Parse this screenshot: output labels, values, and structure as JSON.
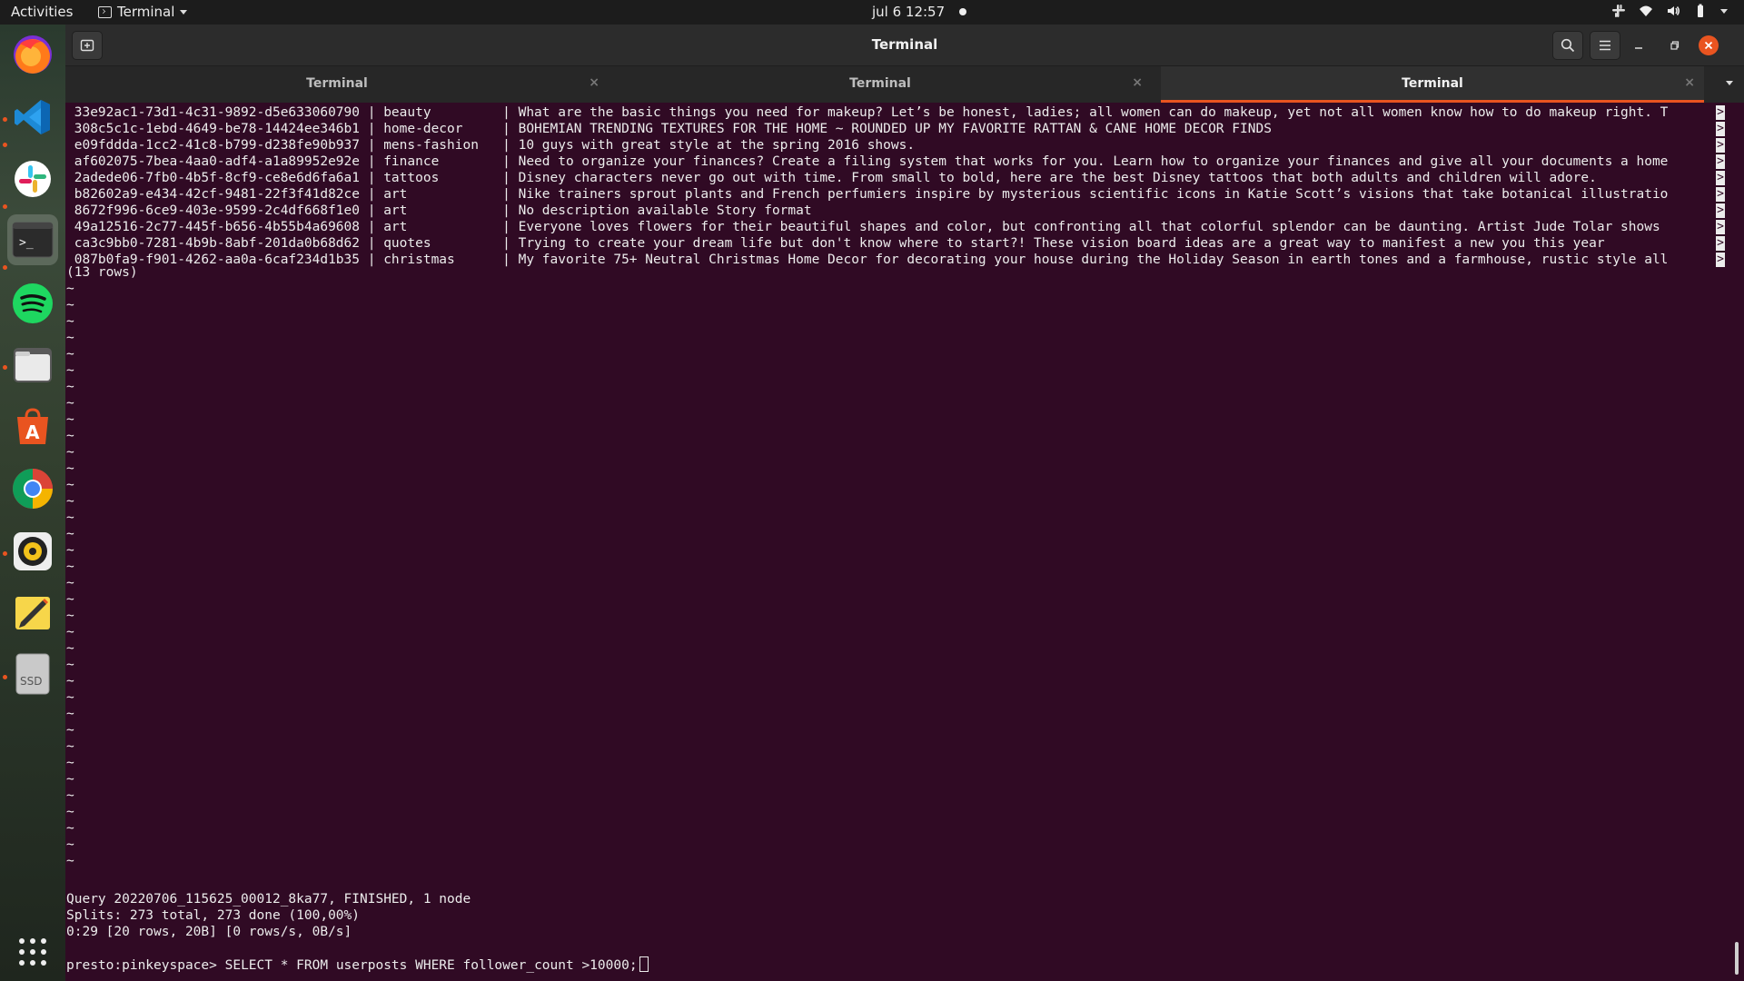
{
  "topbar": {
    "activities": "Activities",
    "app_name": "Terminal",
    "clock": "jul 6  12:57"
  },
  "dock": {
    "items": [
      {
        "name": "firefox-icon",
        "running": true
      },
      {
        "name": "vscode-icon",
        "running": true
      },
      {
        "name": "slack-icon",
        "running": true
      },
      {
        "name": "terminal-icon",
        "running": true,
        "active": true
      },
      {
        "name": "spotify-icon",
        "running": false
      },
      {
        "name": "files-icon",
        "running": true
      },
      {
        "name": "app-center-icon",
        "running": false
      },
      {
        "name": "chrome-icon",
        "running": false
      },
      {
        "name": "rhythmbox-icon",
        "running": true
      },
      {
        "name": "text-editor-icon",
        "running": false
      },
      {
        "name": "ssd-drive-icon",
        "running": true
      }
    ],
    "ssd_label": "SSD"
  },
  "window": {
    "title": "Terminal",
    "tabs": [
      {
        "label": "Terminal",
        "close": "×",
        "active": false
      },
      {
        "label": "Terminal",
        "close": "×",
        "active": false
      },
      {
        "label": "Terminal",
        "close": "×",
        "active": true
      }
    ]
  },
  "terminal": {
    "rows": [
      {
        "id": "33e92ac1-73d1-4c31-9892-d5e633060790",
        "category": "beauty",
        "description": "What are the basic things you need for makeup? Let’s be honest, ladies; all women can do makeup, yet not all women know how to do makeup right. T",
        "overflow": true
      },
      {
        "id": "308c5c1c-1ebd-4649-be78-14424ee346b1",
        "category": "home-decor",
        "description": "BOHEMIAN TRENDING TEXTURES FOR THE HOME ~ ROUNDED UP MY FAVORITE RATTAN & CANE HOME DECOR FINDS",
        "overflow": false
      },
      {
        "id": "e09fddda-1cc2-41c8-b799-d238fe90b937",
        "category": "mens-fashion",
        "description": "10 guys with great style at the spring 2016 shows.",
        "overflow": false
      },
      {
        "id": "af602075-7bea-4aa0-adf4-a1a89952e92e",
        "category": "finance",
        "description": "Need to organize your finances? Create a filing system that works for you. Learn how to organize your finances and give all your documents a home",
        "overflow": true
      },
      {
        "id": "2adede06-7fb0-4b5f-8cf9-ce8e6d6fa6a1",
        "category": "tattoos",
        "description": "Disney characters never go out with time. From small to bold, here are the best Disney tattoos that both adults and children will adore.",
        "overflow": false
      },
      {
        "id": "b82602a9-e434-42cf-9481-22f3f41d82ce",
        "category": "art",
        "description": "Nike trainers sprout plants and French perfumiers inspire by mysterious scientific icons in Katie Scott’s visions that take botanical illustratio",
        "overflow": true
      },
      {
        "id": "8672f996-6ce9-403e-9599-2c4df668f1e0",
        "category": "art",
        "description": "No description available Story format",
        "overflow": false
      },
      {
        "id": "49a12516-2c77-445f-b656-4b55b4a69608",
        "category": "art",
        "description": "Everyone loves flowers for their beautiful shapes and color, but confronting all that colorful splendor can be daunting. Artist Jude Tolar shows ",
        "overflow": true
      },
      {
        "id": "ca3c9bb0-7281-4b9b-8abf-201da0b68d62",
        "category": "quotes",
        "description": "Trying to create your dream life but don't know where to start?! These vision board ideas are a great way to manifest a new you this year",
        "overflow": false
      },
      {
        "id": "087b0fa9-f901-4262-aa0a-6caf234d1b35",
        "category": "christmas",
        "description": "My favorite 75+ Neutral Christmas Home Decor for decorating your house during the Holiday Season in earth tones and a farmhouse, rustic style all",
        "overflow": true
      }
    ],
    "row_count": "(13 rows)",
    "tilde": "~",
    "tilde_lines": 36,
    "query_status": "Query 20220706_115625_00012_8ka77, FINISHED, 1 node",
    "splits": "Splits: 273 total, 273 done (100,00%)",
    "timing": "0:29 [20 rows, 20B] [0 rows/s, 0B/s]",
    "prompt": "presto:pinkeyspace> ",
    "command": "SELECT * FROM userposts WHERE follower_count >10000;"
  },
  "colors": {
    "terminal_bg": "#300a24",
    "accent": "#e95420",
    "text": "#ececec"
  }
}
